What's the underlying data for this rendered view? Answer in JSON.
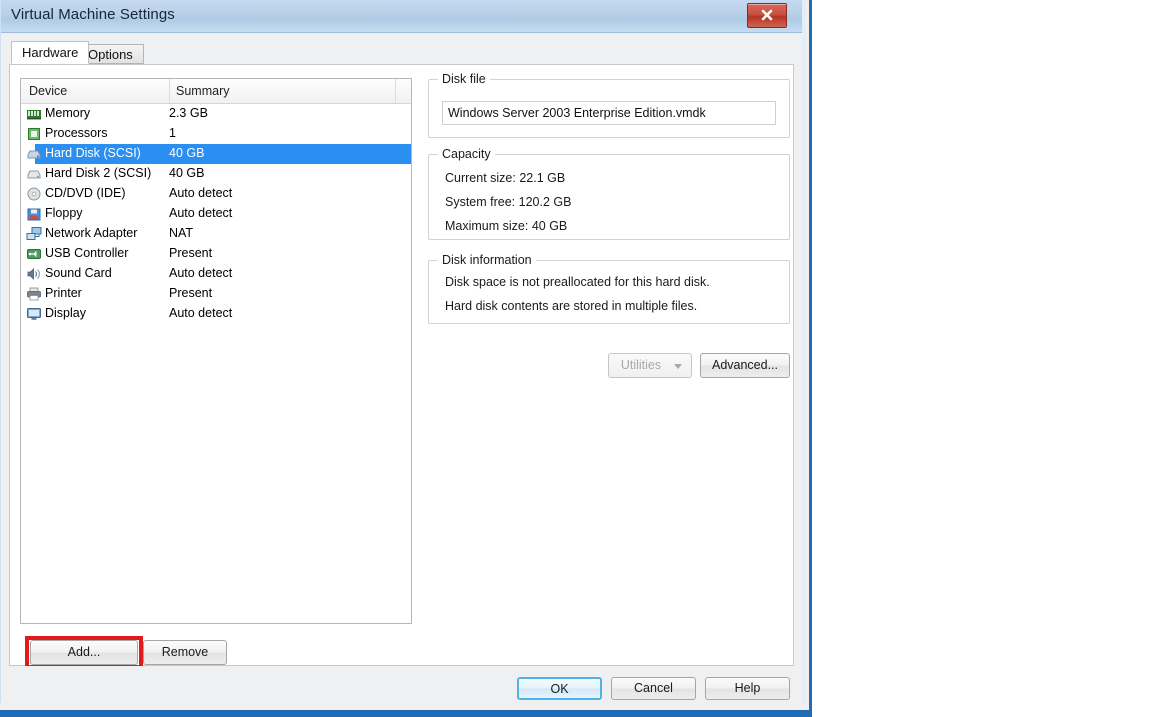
{
  "window": {
    "title": "Virtual Machine Settings",
    "close_icon": "close-icon"
  },
  "tabs": [
    {
      "label": "Hardware",
      "active": true
    },
    {
      "label": "Options",
      "active": false
    }
  ],
  "device_list": {
    "columns": [
      "Device",
      "Summary"
    ],
    "rows": [
      {
        "icon": "memory-icon",
        "device": "Memory",
        "summary": "2.3 GB",
        "selected": false
      },
      {
        "icon": "processor-icon",
        "device": "Processors",
        "summary": "1",
        "selected": false
      },
      {
        "icon": "hard-disk-icon",
        "device": "Hard Disk (SCSI)",
        "summary": "40 GB",
        "selected": true
      },
      {
        "icon": "hard-disk-icon",
        "device": "Hard Disk 2 (SCSI)",
        "summary": "40 GB",
        "selected": false
      },
      {
        "icon": "cd-dvd-icon",
        "device": "CD/DVD (IDE)",
        "summary": "Auto detect",
        "selected": false
      },
      {
        "icon": "floppy-icon",
        "device": "Floppy",
        "summary": "Auto detect",
        "selected": false
      },
      {
        "icon": "network-adapter-icon",
        "device": "Network Adapter",
        "summary": "NAT",
        "selected": false
      },
      {
        "icon": "usb-controller-icon",
        "device": "USB Controller",
        "summary": "Present",
        "selected": false
      },
      {
        "icon": "sound-card-icon",
        "device": "Sound Card",
        "summary": "Auto detect",
        "selected": false
      },
      {
        "icon": "printer-icon",
        "device": "Printer",
        "summary": "Present",
        "selected": false
      },
      {
        "icon": "display-icon",
        "device": "Display",
        "summary": "Auto detect",
        "selected": false
      }
    ]
  },
  "list_buttons": {
    "add": "Add...",
    "remove": "Remove",
    "highlight_color": "#e01b1b",
    "highlighted": "add"
  },
  "disk_file": {
    "group_title": "Disk file",
    "value": "Windows Server 2003 Enterprise Edition.vmdk"
  },
  "capacity": {
    "group_title": "Capacity",
    "lines": [
      "Current size: 22.1 GB",
      "System free: 120.2 GB",
      "Maximum size: 40 GB"
    ]
  },
  "disk_information": {
    "group_title": "Disk information",
    "lines": [
      "Disk space is not preallocated for this hard disk.",
      "Hard disk contents are stored in multiple files."
    ]
  },
  "panel_buttons": {
    "utilities": "Utilities",
    "utilities_enabled": false,
    "advanced": "Advanced..."
  },
  "footer_buttons": {
    "ok": "OK",
    "cancel": "Cancel",
    "help": "Help",
    "focused": "ok",
    "focus_color": "#4eb3e8"
  },
  "colors": {
    "selection": "#2a8ff0",
    "titlebar": "#b9d0e9",
    "window_border": "#1f6eb5"
  }
}
